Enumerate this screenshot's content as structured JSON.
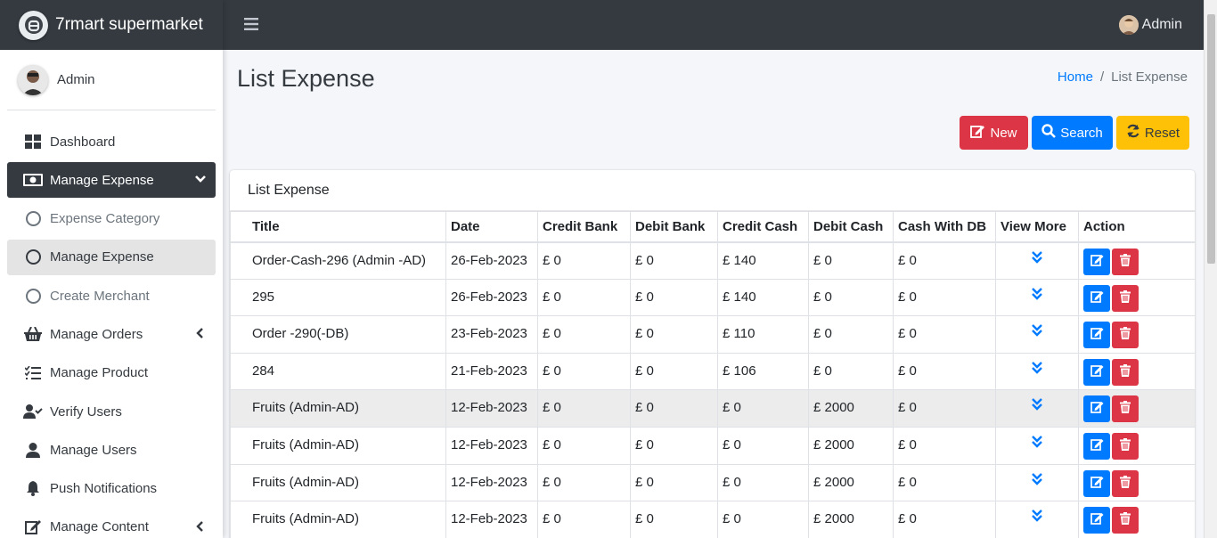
{
  "brand": {
    "name": "7rmart supermarket"
  },
  "sidebar": {
    "user_name": "Admin",
    "items": [
      {
        "label": "Dashboard",
        "icon": "dashboard-icon"
      },
      {
        "label": "Manage Expense",
        "icon": "money-icon",
        "active": true
      },
      {
        "label": "Expense Category",
        "icon": "circle-icon"
      },
      {
        "label": "Manage Expense",
        "icon": "circle-icon"
      },
      {
        "label": "Create Merchant",
        "icon": "circle-icon"
      },
      {
        "label": "Manage Orders",
        "icon": "basket-icon"
      },
      {
        "label": "Manage Product",
        "icon": "list-check-icon"
      },
      {
        "label": "Verify Users",
        "icon": "user-check-icon"
      },
      {
        "label": "Manage Users",
        "icon": "user-icon"
      },
      {
        "label": "Push Notifications",
        "icon": "bell-icon"
      },
      {
        "label": "Manage Content",
        "icon": "edit-icon"
      }
    ]
  },
  "topbar": {
    "user_label": "Admin"
  },
  "page": {
    "title": "List Expense",
    "breadcrumb": {
      "home": "Home",
      "separator": "/",
      "current": "List Expense"
    }
  },
  "actions": {
    "new_label": "New",
    "search_label": "Search",
    "reset_label": "Reset"
  },
  "card": {
    "title": "List Expense"
  },
  "table": {
    "headers": [
      "Title",
      "Date",
      "Credit Bank",
      "Debit Bank",
      "Credit Cash",
      "Debit Cash",
      "Cash With DB",
      "View More",
      "Action"
    ],
    "rows": [
      [
        "Order-Cash-296 (Admin -AD)",
        "26-Feb-2023",
        "£ 0",
        "£ 0",
        "£ 140",
        "£ 0",
        "£ 0"
      ],
      [
        "295",
        "26-Feb-2023",
        "£ 0",
        "£ 0",
        "£ 140",
        "£ 0",
        "£ 0"
      ],
      [
        "Order -290(-DB)",
        "23-Feb-2023",
        "£ 0",
        "£ 0",
        "£ 110",
        "£ 0",
        "£ 0"
      ],
      [
        "284",
        "21-Feb-2023",
        "£ 0",
        "£ 0",
        "£ 106",
        "£ 0",
        "£ 0"
      ],
      [
        "Fruits (Admin-AD)",
        "12-Feb-2023",
        "£ 0",
        "£ 0",
        "£ 0",
        "£ 2000",
        "£ 0"
      ],
      [
        "Fruits (Admin-AD)",
        "12-Feb-2023",
        "£ 0",
        "£ 0",
        "£ 0",
        "£ 2000",
        "£ 0"
      ],
      [
        "Fruits (Admin-AD)",
        "12-Feb-2023",
        "£ 0",
        "£ 0",
        "£ 0",
        "£ 2000",
        "£ 0"
      ],
      [
        "Fruits (Admin-AD)",
        "12-Feb-2023",
        "£ 0",
        "£ 0",
        "£ 0",
        "£ 2000",
        "£ 0"
      ]
    ]
  },
  "colors": {
    "dark": "#343a40",
    "primary": "#007bff",
    "danger": "#dc3545",
    "warning": "#ffc107"
  }
}
